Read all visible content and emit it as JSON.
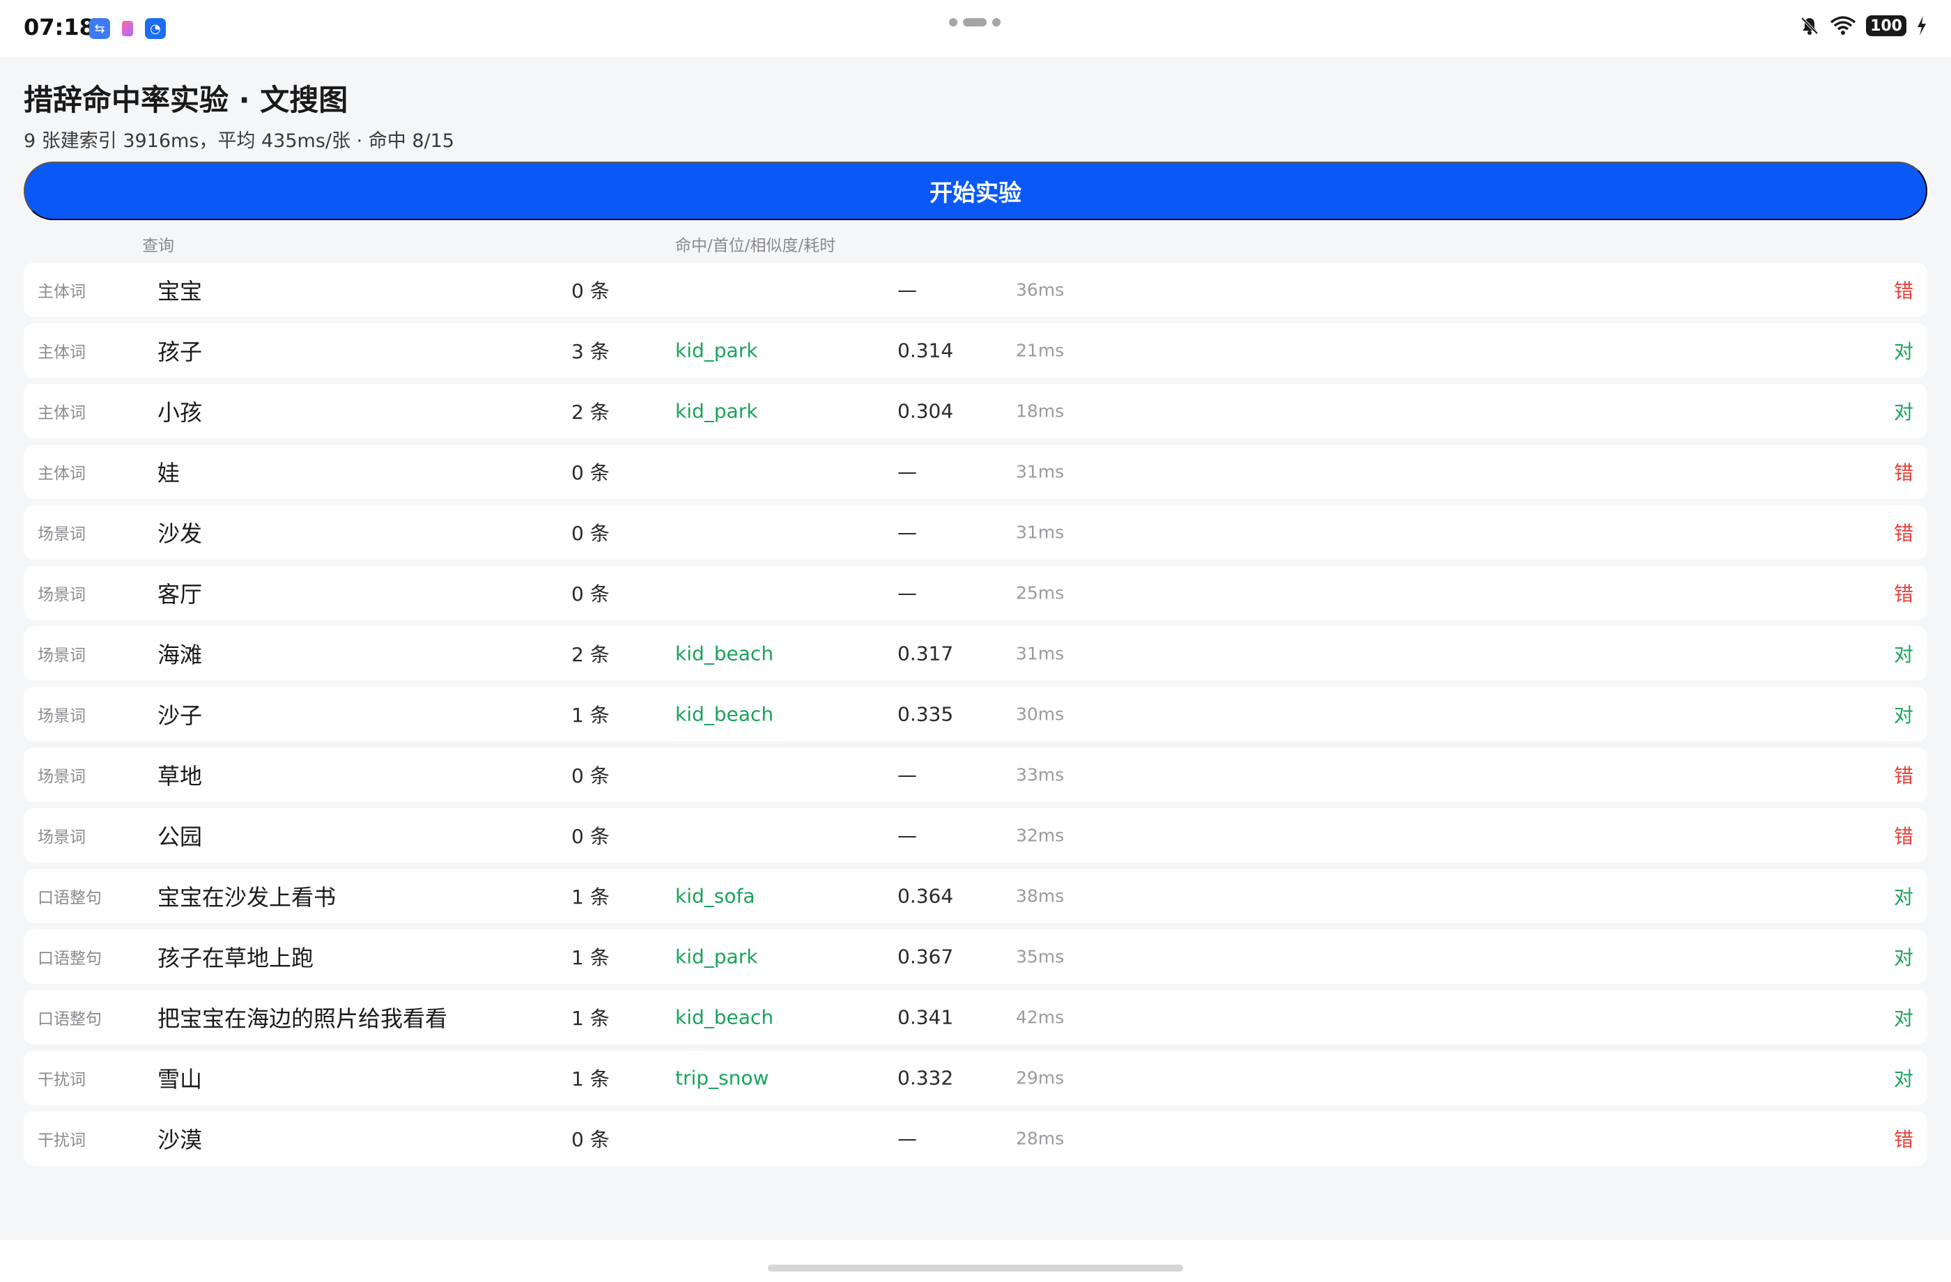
{
  "status": {
    "time": "07:18",
    "battery": "100",
    "icons": [
      "usb-icon",
      "app-icon",
      "assistant-icon",
      "mute-icon",
      "wifi-icon",
      "charging-icon"
    ]
  },
  "header": {
    "title": "措辞命中率实验 · 文搜图",
    "subtitle": "9 张建索引 3916ms，平均 435ms/张 · 命中 8/15"
  },
  "start_button": "开始实验",
  "columns": {
    "query": "查询",
    "metrics": "命中/首位/相似度/耗时"
  },
  "colors": {
    "accent": "#0a59f7",
    "ok": "#1aa35a",
    "bad": "#e8403a"
  },
  "rows": [
    {
      "category": "主体词",
      "query": "宝宝",
      "count": "0 条",
      "top": "",
      "sim": "—",
      "time": "36ms",
      "result": "错"
    },
    {
      "category": "主体词",
      "query": "孩子",
      "count": "3 条",
      "top": "kid_park",
      "sim": "0.314",
      "time": "21ms",
      "result": "对"
    },
    {
      "category": "主体词",
      "query": "小孩",
      "count": "2 条",
      "top": "kid_park",
      "sim": "0.304",
      "time": "18ms",
      "result": "对"
    },
    {
      "category": "主体词",
      "query": "娃",
      "count": "0 条",
      "top": "",
      "sim": "—",
      "time": "31ms",
      "result": "错"
    },
    {
      "category": "场景词",
      "query": "沙发",
      "count": "0 条",
      "top": "",
      "sim": "—",
      "time": "31ms",
      "result": "错"
    },
    {
      "category": "场景词",
      "query": "客厅",
      "count": "0 条",
      "top": "",
      "sim": "—",
      "time": "25ms",
      "result": "错"
    },
    {
      "category": "场景词",
      "query": "海滩",
      "count": "2 条",
      "top": "kid_beach",
      "sim": "0.317",
      "time": "31ms",
      "result": "对"
    },
    {
      "category": "场景词",
      "query": "沙子",
      "count": "1 条",
      "top": "kid_beach",
      "sim": "0.335",
      "time": "30ms",
      "result": "对"
    },
    {
      "category": "场景词",
      "query": "草地",
      "count": "0 条",
      "top": "",
      "sim": "—",
      "time": "33ms",
      "result": "错"
    },
    {
      "category": "场景词",
      "query": "公园",
      "count": "0 条",
      "top": "",
      "sim": "—",
      "time": "32ms",
      "result": "错"
    },
    {
      "category": "口语整句",
      "query": "宝宝在沙发上看书",
      "count": "1 条",
      "top": "kid_sofa",
      "sim": "0.364",
      "time": "38ms",
      "result": "对"
    },
    {
      "category": "口语整句",
      "query": "孩子在草地上跑",
      "count": "1 条",
      "top": "kid_park",
      "sim": "0.367",
      "time": "35ms",
      "result": "对"
    },
    {
      "category": "口语整句",
      "query": "把宝宝在海边的照片给我看看",
      "count": "1 条",
      "top": "kid_beach",
      "sim": "0.341",
      "time": "42ms",
      "result": "对"
    },
    {
      "category": "干扰词",
      "query": "雪山",
      "count": "1 条",
      "top": "trip_snow",
      "sim": "0.332",
      "time": "29ms",
      "result": "对"
    },
    {
      "category": "干扰词",
      "query": "沙漠",
      "count": "0 条",
      "top": "",
      "sim": "—",
      "time": "28ms",
      "result": "错"
    }
  ]
}
